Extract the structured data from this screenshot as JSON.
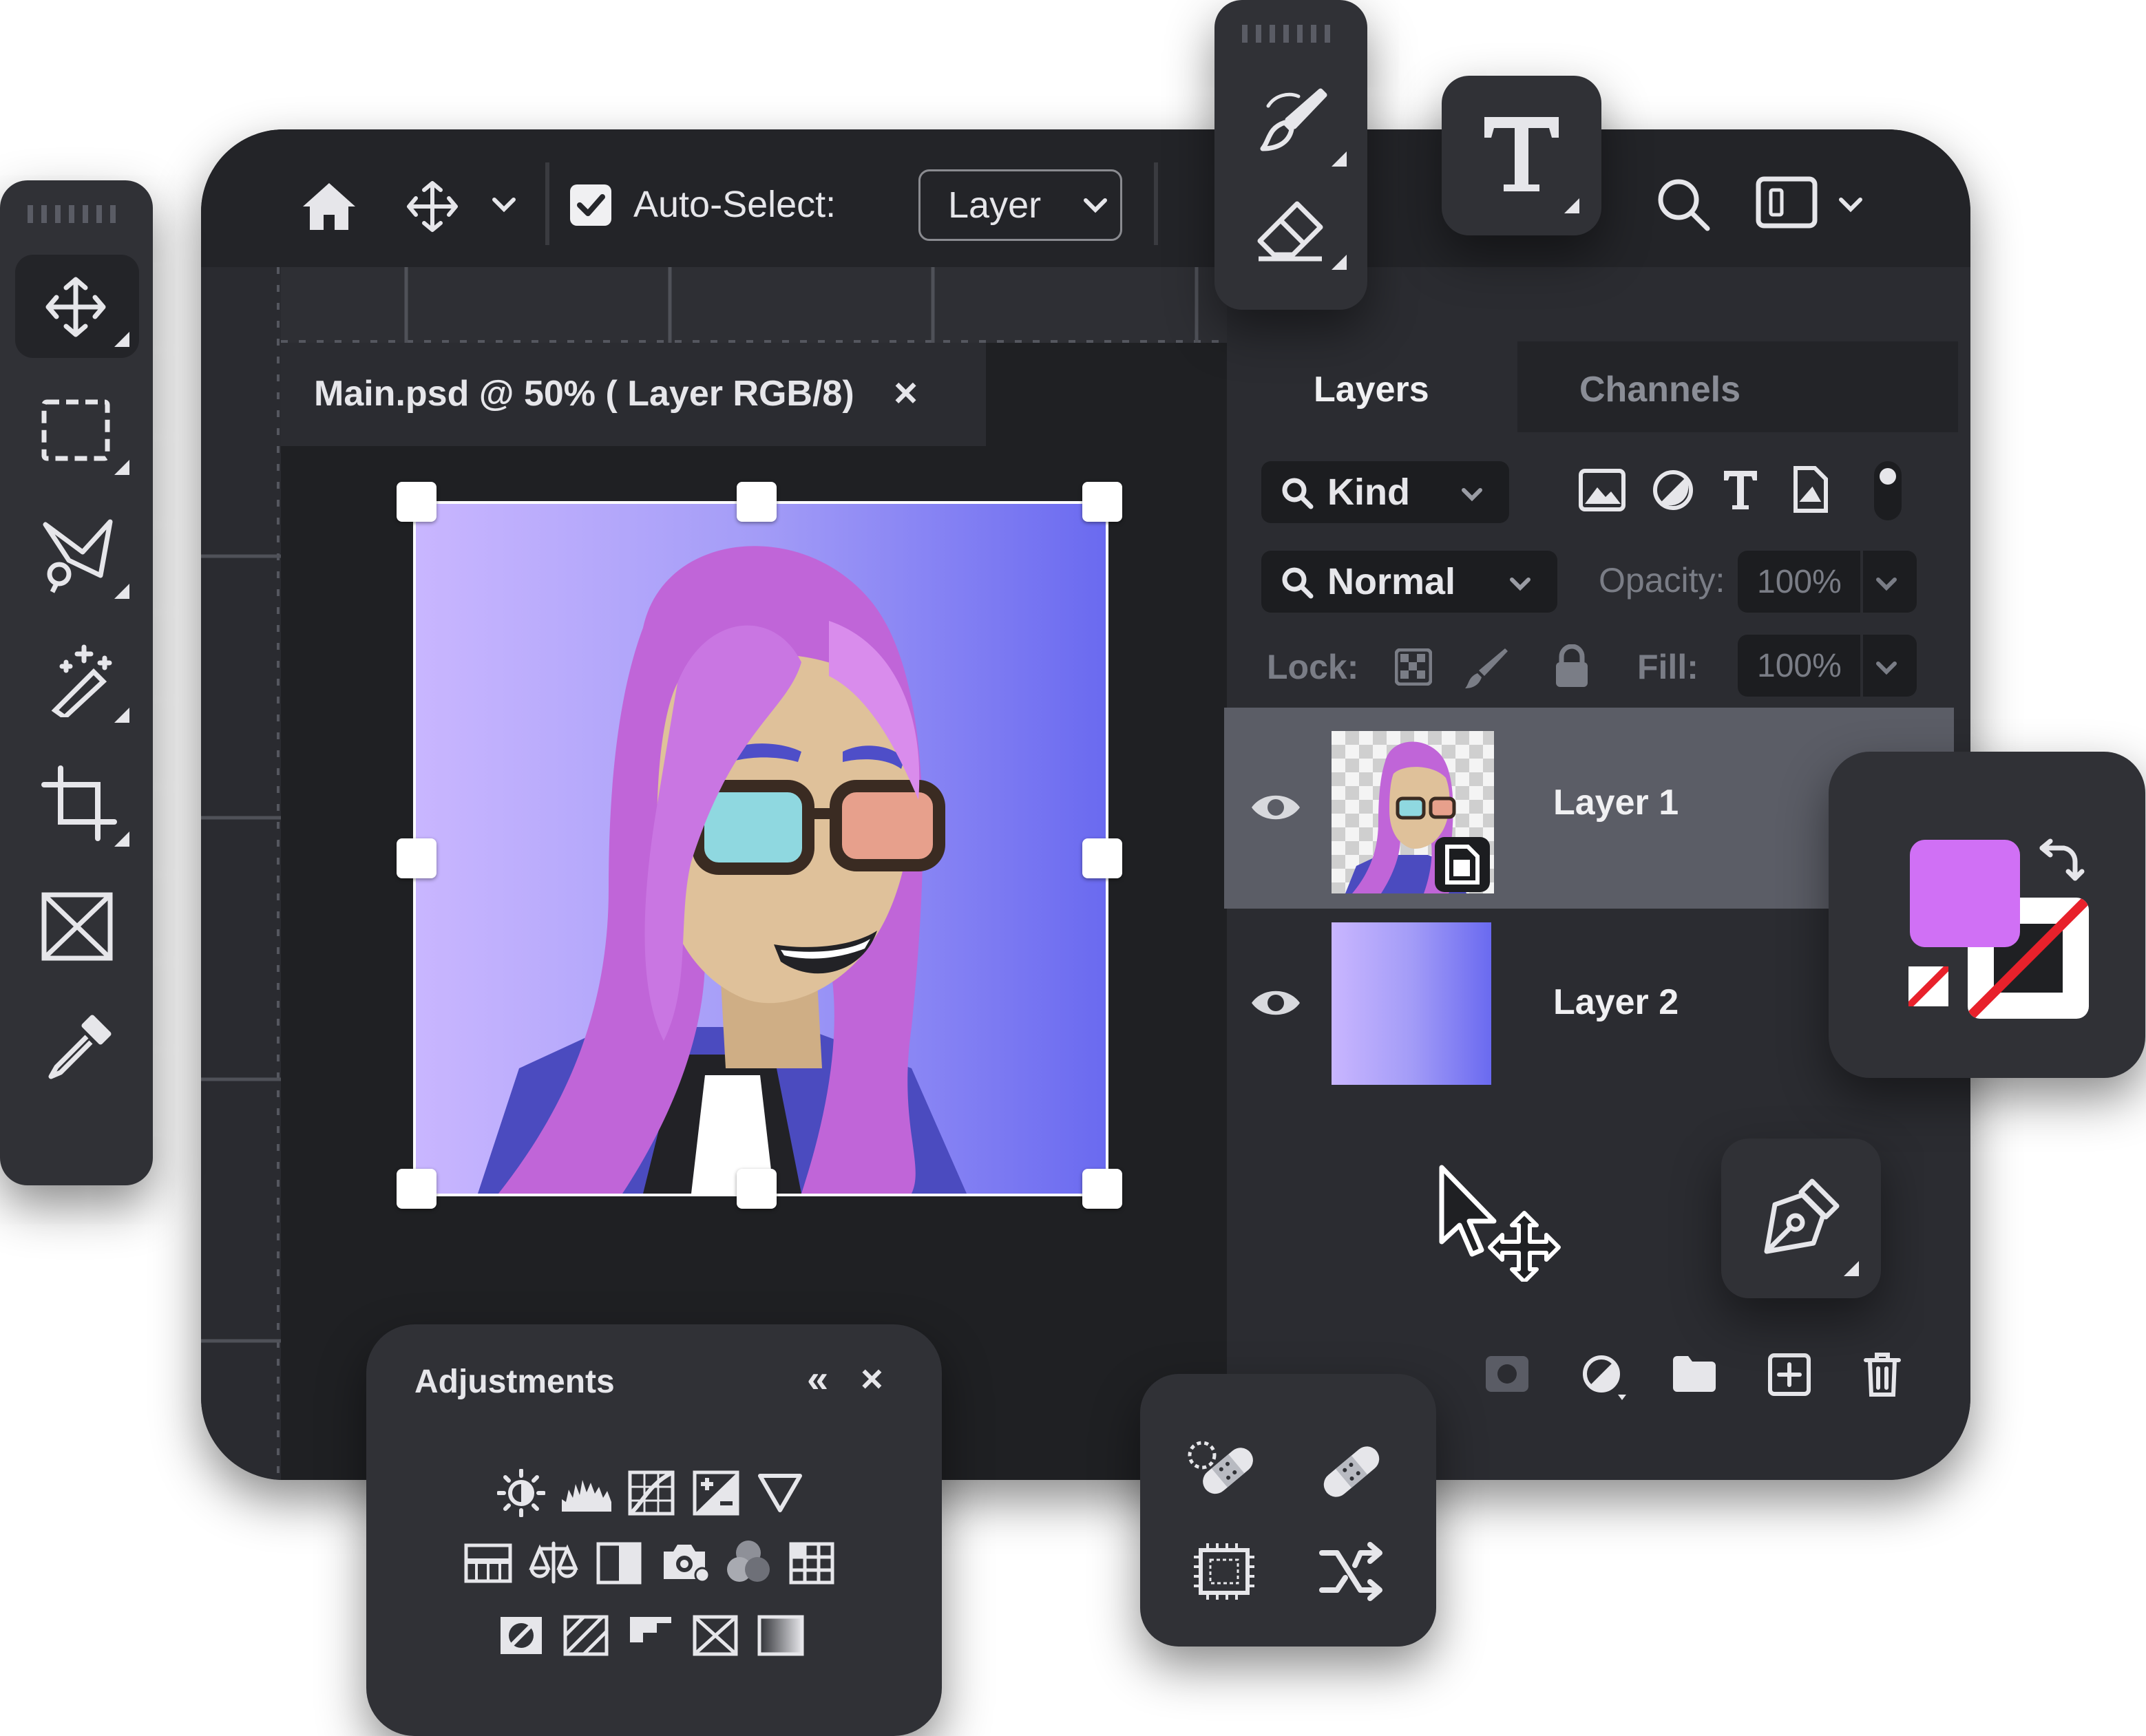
{
  "toolbar": {
    "auto_select_label": "Auto-Select:",
    "auto_select_checked": true,
    "layer_dropdown_value": "Layer"
  },
  "document_tab": {
    "title": "Main.psd @ 50% ( Layer RGB/8)",
    "close_symbol": "×"
  },
  "layers_panel": {
    "tabs": [
      {
        "label": "Layers",
        "active": true
      },
      {
        "label": "Channels",
        "active": false
      }
    ],
    "kind_filter": "Kind",
    "blend_mode": "Normal",
    "opacity_label": "Opacity:",
    "opacity_value": "100%",
    "lock_label": "Lock:",
    "fill_label": "Fill:",
    "fill_value": "100%",
    "layers": [
      {
        "name": "Layer 1",
        "selected": true,
        "visible": true
      },
      {
        "name": "Layer 2",
        "selected": false,
        "visible": true
      }
    ]
  },
  "adjustments_panel": {
    "title": "Adjustments",
    "collapse_symbol": "«",
    "close_symbol": "×"
  },
  "colors": {
    "foreground": "#d070f5",
    "background": "#ffffff",
    "accent_gradient_start": "#c9b6ff",
    "accent_gradient_end": "#6a6af0",
    "hair": "#c065d8",
    "skin": "#dfc19a"
  },
  "icons": {
    "left_toolbar": [
      "move-icon",
      "marquee-icon",
      "lasso-icon",
      "magic-wand-icon",
      "crop-icon",
      "frame-icon",
      "eyedropper-icon"
    ],
    "floating_brush_eraser": [
      "brush-icon",
      "eraser-icon"
    ],
    "floating_text": "type-icon",
    "floating_pen": "pen-icon",
    "healing_tools": [
      "spot-healing-icon",
      "healing-bandage-icon",
      "content-aware-icon",
      "shuffle-icon"
    ],
    "layer_filters": [
      "image-filter-icon",
      "adjustment-filter-icon",
      "type-filter-icon",
      "shape-filter-icon",
      "toggle-dot-icon"
    ],
    "layer_actions": [
      "mask-icon",
      "adjustment-layer-icon",
      "group-folder-icon",
      "new-layer-icon",
      "trash-icon"
    ]
  }
}
